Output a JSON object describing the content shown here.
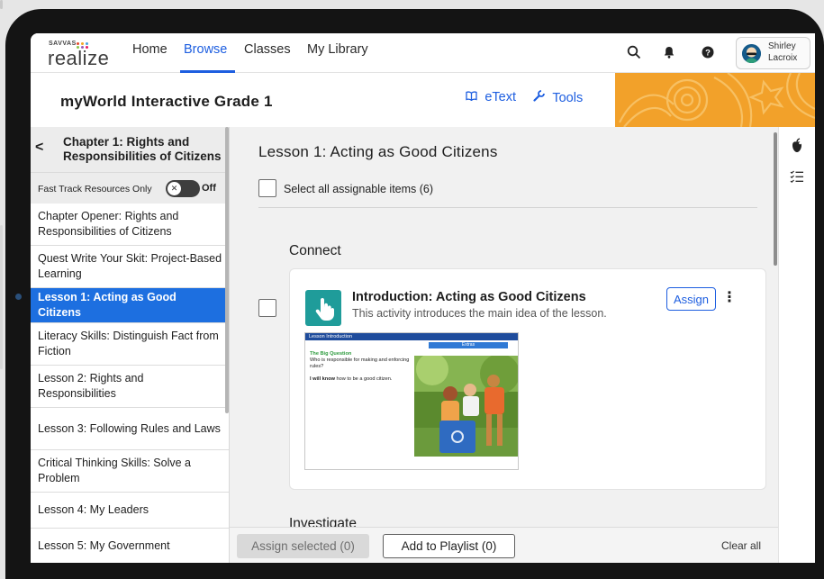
{
  "brand": {
    "small": "SAVVAS",
    "name": "realize"
  },
  "nav": {
    "items": [
      "Home",
      "Browse",
      "Classes",
      "My Library"
    ],
    "active": "Browse"
  },
  "header_icons": {
    "search": "search-icon",
    "notifications": "bell-icon",
    "help": "help-icon"
  },
  "user": {
    "first_name": "Shirley",
    "last_name": "Lacroix"
  },
  "program": {
    "title": "myWorld Interactive Grade 1"
  },
  "toolbar": {
    "etext_label": "eText",
    "tools_label": "Tools"
  },
  "sidebar": {
    "back": "<",
    "chapter_title": "Chapter 1: Rights and Responsibilities of Citizens",
    "fast_track_label": "Fast Track Resources Only",
    "fast_track_state": "Off",
    "items": [
      {
        "label": "Chapter Opener: Rights and Responsibilities of Citizens"
      },
      {
        "label": "Quest Write Your Skit: Project-Based Learning"
      },
      {
        "label": "Lesson 1: Acting as Good Citizens"
      },
      {
        "label": "Literacy Skills: Distinguish Fact from Fiction"
      },
      {
        "label": "Lesson 2: Rights and Responsibilities"
      },
      {
        "label": "Lesson 3: Following Rules and Laws"
      },
      {
        "label": "Critical Thinking Skills: Solve a Problem"
      },
      {
        "label": "Lesson 4: My Leaders"
      },
      {
        "label": "Lesson 5: My Government"
      }
    ],
    "active_index": 2
  },
  "main": {
    "lesson_title": "Lesson 1: Acting as Good Citizens",
    "select_all_label": "Select all assignable items (6)",
    "section_connect": "Connect",
    "section_next": "Investigate",
    "card": {
      "title": "Introduction: Acting as Good Citizens",
      "description": "This activity introduces the main idea of the lesson.",
      "assign_label": "Assign",
      "more_label": "⋮",
      "thumbnail": {
        "bar_label": "Lesson Introduction",
        "extras_label": "Extras",
        "question_heading": "The Big Question",
        "question_text": "Who is responsible for making and enforcing rules?",
        "will_know_bold": "I will know",
        "will_know_text": " how to be a good citizen."
      }
    }
  },
  "footer": {
    "assign_selected": "Assign selected (0)",
    "add_to_playlist": "Add to Playlist (0)",
    "clear_all": "Clear all"
  },
  "rail_icons": [
    "apple-icon",
    "checklist-icon"
  ],
  "colors": {
    "accent": "#1d5ee0",
    "active_item": "#1d6fe0",
    "activity_icon": "#1f9c9a",
    "banner": "#f2a12a"
  }
}
